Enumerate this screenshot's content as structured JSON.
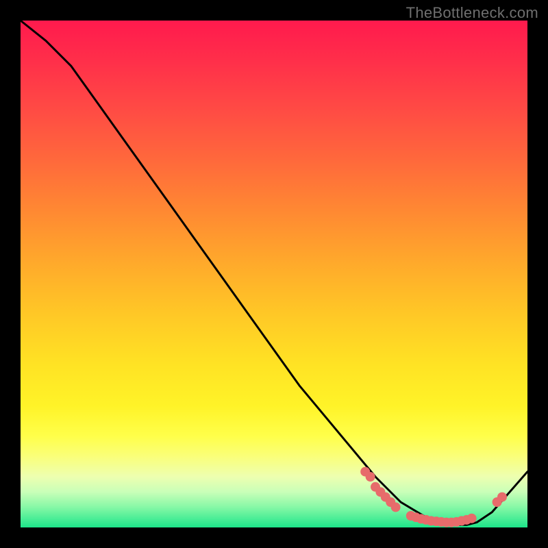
{
  "watermark": "TheBottleneck.com",
  "chart_data": {
    "type": "line",
    "title": "",
    "xlabel": "",
    "ylabel": "",
    "xlim": [
      0,
      100
    ],
    "ylim": [
      0,
      100
    ],
    "series": [
      {
        "name": "bottleneck-curve",
        "x": [
          0,
          5,
          10,
          15,
          20,
          25,
          30,
          35,
          40,
          45,
          50,
          55,
          60,
          65,
          70,
          75,
          80,
          82,
          85,
          88,
          90,
          93,
          100
        ],
        "y": [
          100,
          96,
          91,
          84,
          77,
          70,
          63,
          56,
          49,
          42,
          35,
          28,
          22,
          16,
          10,
          5,
          2,
          1,
          0.5,
          0.5,
          1,
          3,
          11
        ]
      }
    ],
    "markers": {
      "name": "highlight-dots",
      "color": "#e76b6b",
      "points": [
        {
          "x": 68,
          "y": 11
        },
        {
          "x": 69,
          "y": 10
        },
        {
          "x": 70,
          "y": 8
        },
        {
          "x": 71,
          "y": 7
        },
        {
          "x": 72,
          "y": 6
        },
        {
          "x": 73,
          "y": 5
        },
        {
          "x": 74,
          "y": 4
        },
        {
          "x": 77,
          "y": 2.3
        },
        {
          "x": 78,
          "y": 2
        },
        {
          "x": 79,
          "y": 1.7
        },
        {
          "x": 80,
          "y": 1.5
        },
        {
          "x": 81,
          "y": 1.3
        },
        {
          "x": 82,
          "y": 1.2
        },
        {
          "x": 83,
          "y": 1.1
        },
        {
          "x": 84,
          "y": 1.0
        },
        {
          "x": 85,
          "y": 1.0
        },
        {
          "x": 86,
          "y": 1.1
        },
        {
          "x": 87,
          "y": 1.3
        },
        {
          "x": 88,
          "y": 1.5
        },
        {
          "x": 89,
          "y": 1.8
        },
        {
          "x": 94,
          "y": 5
        },
        {
          "x": 95,
          "y": 6
        }
      ]
    }
  }
}
